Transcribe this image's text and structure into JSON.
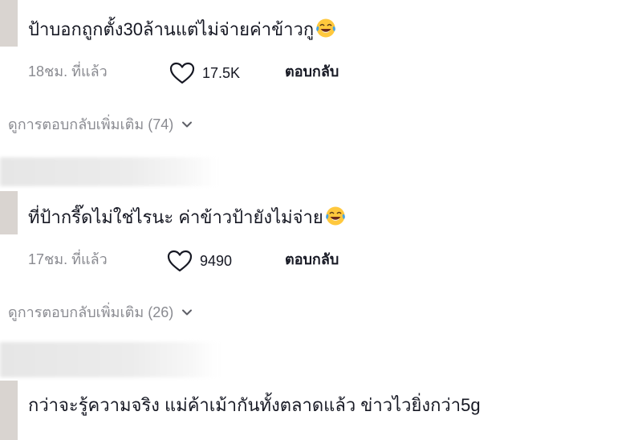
{
  "comments": [
    {
      "text": "ป้าบอกถูกตั้ง30ล้านแต่ไม่จ่ายค่าข้าวกู",
      "emoji": "face-with-tears-of-joy",
      "time": "18ชม. ที่แล้ว",
      "likes": "17.5K",
      "reply_label": "ตอบกลับ",
      "view_replies": "ดูการตอบกลับเพิ่มเติม (74)"
    },
    {
      "text": "ที่ป้ากรี๊ดไม่ใช่ไรนะ ค่าข้าวป้ายังไม่จ่าย",
      "emoji": "face-with-tears-of-joy",
      "time": "17ชม. ที่แล้ว",
      "likes": "9490",
      "reply_label": "ตอบกลับ",
      "view_replies": "ดูการตอบกลับเพิ่มเติม (26)"
    },
    {
      "text": "กว่าจะรู้ความจริง แม่ค้าเม้ากันทั้งตลาดแล้ว ข่าวไวยิ่งกว่า5g"
    }
  ],
  "colors": {
    "text": "#161823",
    "muted": "#8a8b91",
    "emoji_face": "#ffc83d",
    "emoji_tears": "#4aa3df"
  }
}
